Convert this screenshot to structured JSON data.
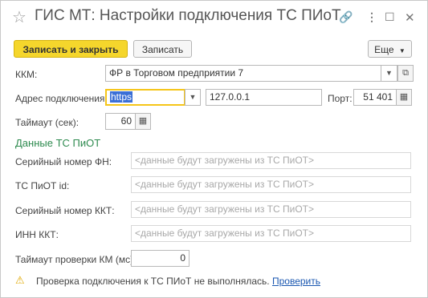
{
  "window": {
    "title": "ГИС МТ: Настройки подключения ТС ПИоТ"
  },
  "toolbar": {
    "save_close_label": "Записать и закрыть",
    "save_label": "Записать",
    "more_label": "Еще"
  },
  "form": {
    "kkm_label": "ККМ:",
    "kkm_value": "ФР в Торговом предприятии 7",
    "address_label": "Адрес подключения:",
    "protocol_value": "https",
    "host_value": "127.0.0.1",
    "port_label": "Порт:",
    "port_value": "51 401",
    "timeout_label": "Таймаут (сек):",
    "timeout_value": "60"
  },
  "piot_section": {
    "title": "Данные ТС ПиОТ",
    "fn_serial_label": "Серийный номер ФН:",
    "fn_serial_placeholder": "<данные будут загружены из ТС ПиОТ>",
    "piot_id_label": "ТС ПиОТ id:",
    "piot_id_placeholder": "<данные будут загружены из ТС ПиОТ>",
    "kkt_serial_label": "Серийный номер ККТ:",
    "kkt_serial_placeholder": "<данные будут загружены из ТС ПиОТ>",
    "inn_label": "ИНН ККТ:",
    "inn_placeholder": "<данные будут загружены из ТС ПиОТ>",
    "km_timeout_label": "Таймаут проверки КМ (мс):",
    "km_timeout_value": "0"
  },
  "status": {
    "message": "Проверка подключения к ТС ПИоТ не выполнялась.",
    "link": "Проверить"
  }
}
